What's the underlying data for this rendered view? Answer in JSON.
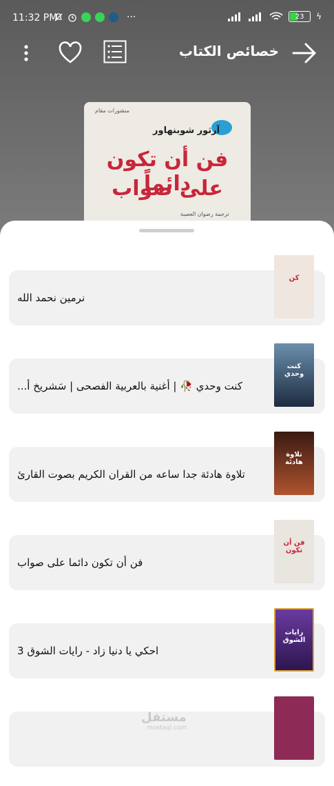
{
  "status": {
    "time": "11:32 PM",
    "battery": "23"
  },
  "appbar": {
    "title": "خصائص الكتاب"
  },
  "cover": {
    "publisher": "منشورات مقام",
    "author": "آرثور شوبنهاور",
    "title_line1": "فن أن تكون دائماً",
    "title_line2": "على صواب",
    "translator": "ترجمة رضوان العصبة"
  },
  "items": [
    {
      "label": "نرمين نحمد الله",
      "thumb_color": "#efe6df",
      "thumb_text": "كن"
    },
    {
      "label": "كنت وحدي 🥀 | أغنية بالعربية الفصحى | سَشريخ أ...",
      "thumb_color": "#2c4f6b",
      "thumb_text": "كنت وحدي"
    },
    {
      "label": "تلاوة هادئة جدا ساعه من القران الكريم بصوت القارئ",
      "thumb_color": "#7a3b25",
      "thumb_text": "تلاوة هادئة"
    },
    {
      "label": "فن أن تكون دائما على صواب",
      "thumb_color": "#e9e5df",
      "thumb_text": "فن أن تكون"
    },
    {
      "label": "احكي يا دنيا زاد - رايات الشوق 3",
      "thumb_color": "#4b2a7a",
      "thumb_text": "رايات الشوق"
    },
    {
      "label": "",
      "thumb_color": "#8d2a55",
      "thumb_text": ""
    }
  ],
  "watermark": {
    "text": "مستقل",
    "sub": "mostaql.com"
  },
  "colors": {
    "accent_red": "#c8263a",
    "card_bg": "#f1f1f1"
  }
}
